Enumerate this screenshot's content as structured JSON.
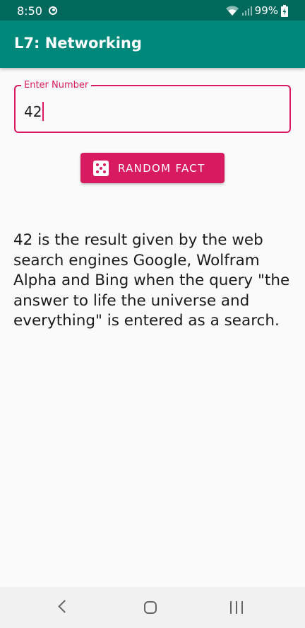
{
  "status_bar": {
    "time": "8:50",
    "battery": "99%",
    "icons": [
      "sync-icon",
      "wifi-icon",
      "signal-icon",
      "battery-icon"
    ]
  },
  "app_bar": {
    "title": "L7: Networking",
    "color": "#00897b"
  },
  "number_input": {
    "label": "Enter Number",
    "value": "42",
    "accent_color": "#d81b60"
  },
  "random_button": {
    "label": "RANDOM FACT",
    "icon": "dice-icon",
    "color": "#d81b60"
  },
  "fact": {
    "text": "42 is the result given by the web search engines Google, Wolfram Alpha and Bing when the query \"the answer to life the universe and everything\" is entered as a search."
  },
  "nav_bar": {
    "buttons": [
      "back-icon",
      "home-icon",
      "recents-icon"
    ]
  }
}
